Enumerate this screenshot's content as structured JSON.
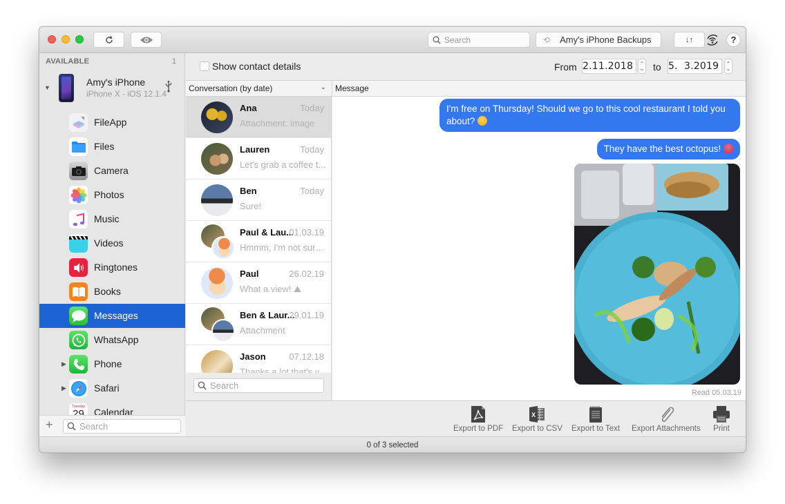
{
  "toolbar": {
    "search_placeholder": "Search",
    "backups_label": "Amy's iPhone Backups",
    "transfer_label": "↓↑",
    "help_label": "?"
  },
  "sidebar": {
    "header": "AVAILABLE",
    "count": "1",
    "device": {
      "name": "Amy's iPhone",
      "subtitle": "iPhone X - iOS 12.1.4"
    },
    "items": [
      {
        "label": "FileApp",
        "icon": "fileapp-icon",
        "color": "#e8e8f0",
        "expandable": false,
        "selected": false
      },
      {
        "label": "Files",
        "icon": "files-folder-icon",
        "color": "#1e8cf0",
        "expandable": false,
        "selected": false
      },
      {
        "label": "Camera",
        "icon": "camera-icon",
        "color": "#8e8e8e",
        "expandable": false,
        "selected": false
      },
      {
        "label": "Photos",
        "icon": "photos-icon",
        "color": "#f5a623",
        "expandable": false,
        "selected": false
      },
      {
        "label": "Music",
        "icon": "music-note-icon",
        "color": "#fc3c6e",
        "expandable": false,
        "selected": false
      },
      {
        "label": "Videos",
        "icon": "videos-clapper-icon",
        "color": "#3cd0e8",
        "expandable": false,
        "selected": false
      },
      {
        "label": "Ringtones",
        "icon": "ringtones-speaker-icon",
        "color": "#e8213f",
        "expandable": false,
        "selected": false
      },
      {
        "label": "Books",
        "icon": "books-icon",
        "color": "#f5831f",
        "expandable": false,
        "selected": false
      },
      {
        "label": "Messages",
        "icon": "messages-bubble-icon",
        "color": "#34c759",
        "expandable": false,
        "selected": true
      },
      {
        "label": "WhatsApp",
        "icon": "whatsapp-icon",
        "color": "#2ac544",
        "expandable": false,
        "selected": false
      },
      {
        "label": "Phone",
        "icon": "phone-handset-icon",
        "color": "#2ac544",
        "expandable": true,
        "selected": false
      },
      {
        "label": "Safari",
        "icon": "safari-compass-icon",
        "color": "#1a8cf0",
        "expandable": true,
        "selected": false
      },
      {
        "label": "Calendar",
        "icon": "calendar-icon",
        "color": "#ffffff",
        "expandable": false,
        "selected": false,
        "calendar_day": "Tuesday",
        "calendar_date": "29"
      }
    ],
    "search_placeholder": "Search",
    "add_label": "+"
  },
  "filter": {
    "show_contact_details_label": "Show contact details",
    "show_contact_details_checked": false,
    "from_label": "From",
    "from_date": "2.11.2018",
    "to_label": "to",
    "to_date": "5.  3.2019"
  },
  "columns": {
    "conversation_header": "Conversation (by date)",
    "message_header": "Message"
  },
  "conversations": [
    {
      "name": "Ana",
      "date": "Today",
      "preview": "Attachment: image",
      "selected": true,
      "avatar": "single",
      "avatar_colors": [
        "#2c3140",
        "#e2b42c"
      ]
    },
    {
      "name": "Lauren",
      "date": "Today",
      "preview": "Let's grab a coffee t...",
      "selected": false,
      "avatar": "single",
      "avatar_colors": [
        "#5b6b4a",
        "#c89a6a"
      ]
    },
    {
      "name": "Ben",
      "date": "Today",
      "preview": "Sure!",
      "selected": false,
      "avatar": "single",
      "avatar_colors": [
        "#466a9a",
        "#e8eaf0"
      ]
    },
    {
      "name": "Paul & Lau...",
      "date": "01.03.19",
      "preview": "Hmmm, I'm not sure...",
      "selected": false,
      "avatar": "pair",
      "avatar_colors": [
        "#5b6b4a",
        "#f08a4b"
      ]
    },
    {
      "name": "Paul",
      "date": "26.02.19",
      "preview": "What a view! ⛰",
      "selected": false,
      "avatar": "single",
      "avatar_colors": [
        "#dfe8f8",
        "#f08a4b"
      ]
    },
    {
      "name": "Ben & Laur...",
      "date": "29.01.19",
      "preview": "Attachment",
      "selected": false,
      "avatar": "pair",
      "avatar_colors": [
        "#5b6b4a",
        "#466a9a"
      ]
    },
    {
      "name": "Jason",
      "date": "07.12.18",
      "preview": "Thanks a lot that's v...",
      "selected": false,
      "avatar": "single",
      "avatar_colors": [
        "#c89a4a",
        "#f0e0c0"
      ]
    }
  ],
  "conversation_search_placeholder": "Search",
  "messages": [
    {
      "text": "I'm free on Thursday! Should we go to this cool restaurant I told you about?",
      "emoji": "slightly-smiling-face"
    },
    {
      "text": "They have the best octopus!",
      "emoji": "octopus"
    }
  ],
  "attachment": {
    "type": "image",
    "description": "Plate of grilled octopus with broccoli on a blue plate"
  },
  "read_status": "Read 05.03.19",
  "actions": [
    {
      "label": "Export to PDF",
      "icon": "pdf-icon"
    },
    {
      "label": "Export to CSV",
      "icon": "excel-csv-icon"
    },
    {
      "label": "Export to Text",
      "icon": "text-notepad-icon"
    },
    {
      "label": "Export Attachments",
      "icon": "paperclip-icon"
    },
    {
      "label": "Print",
      "icon": "printer-icon"
    }
  ],
  "status": "0 of 3 selected",
  "colors": {
    "accent": "#1e63d3",
    "bubble": "#3478f0",
    "selected_row": "#dcdcdc"
  }
}
